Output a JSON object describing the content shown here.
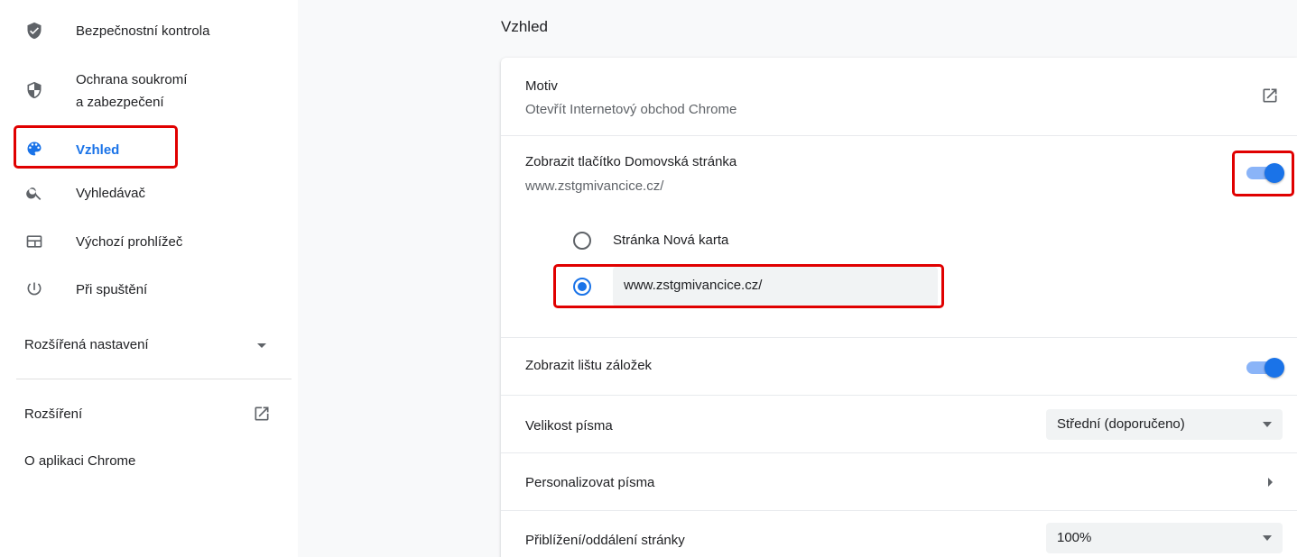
{
  "sidebar": {
    "items": [
      {
        "label": "Bezpečnostní kontrola",
        "icon": "shield-check-icon"
      },
      {
        "label": "Ochrana soukromí",
        "label2": "a zabezpečení",
        "icon": "shield-icon"
      },
      {
        "label": "Vzhled",
        "icon": "palette-icon"
      },
      {
        "label": "Vyhledávač",
        "icon": "search-icon"
      },
      {
        "label": "Výchozí prohlížeč",
        "icon": "browser-window-icon"
      },
      {
        "label": "Při spuštění",
        "icon": "power-icon"
      }
    ],
    "advanced_label": "Rozšířená nastavení",
    "extensions_label": "Rozšíření",
    "about_label": "O aplikaci Chrome"
  },
  "main": {
    "title": "Vzhled",
    "theme": {
      "title": "Motiv",
      "subtitle": "Otevřít Internetový obchod Chrome"
    },
    "home_button": {
      "title": "Zobrazit tlačítko Domovská stránka",
      "subtitle": "www.zstgmivancice.cz/",
      "enabled": true,
      "options": [
        {
          "label": "Stránka Nová karta",
          "checked": false
        },
        {
          "value": "www.zstgmivancice.cz/",
          "checked": true
        }
      ]
    },
    "bookmarks_bar": {
      "title": "Zobrazit lištu záložek",
      "enabled": true
    },
    "font_size": {
      "title": "Velikost písma",
      "value": "Střední (doporučeno)"
    },
    "customize_fonts": {
      "title": "Personalizovat písma"
    },
    "zoom": {
      "title": "Přiblížení/oddálení stránky",
      "value": "100%"
    }
  },
  "colors": {
    "accent": "#1a73e8",
    "highlight": "#e00000"
  }
}
